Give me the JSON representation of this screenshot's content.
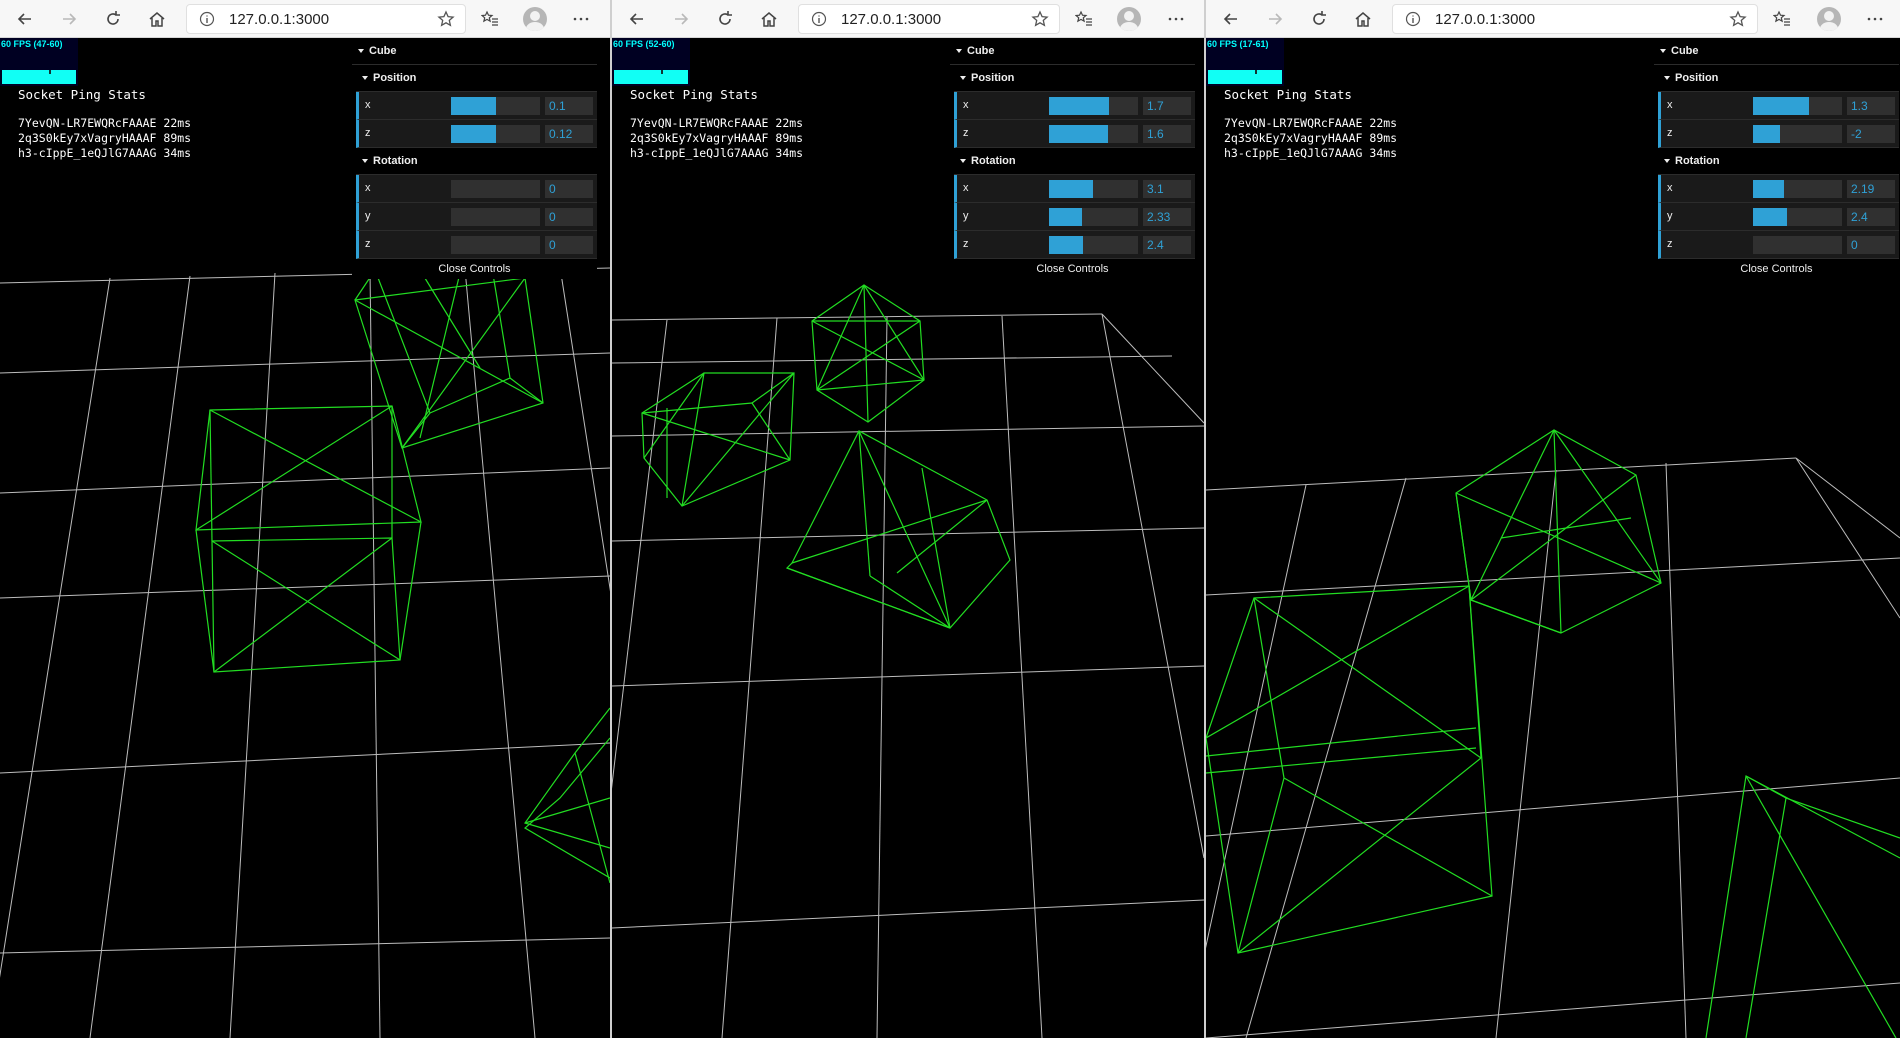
{
  "windows": [
    {
      "url": "127.0.0.1:3000",
      "fps": "60 FPS (47-60)",
      "ping": {
        "title": "Socket Ping Stats",
        "rows": [
          "7YevQN-LR7EWQRcFAAAE 22ms",
          "2q3S0kEy7xVagryHAAAF 89ms",
          "h3-cIppE_1eQJlG7AAAG 34ms"
        ]
      },
      "gui": {
        "folder": "Cube",
        "position_title": "Position",
        "position": [
          {
            "label": "x",
            "value": "0.1",
            "fill": 0.5
          },
          {
            "label": "z",
            "value": "0.12",
            "fill": 0.51
          }
        ],
        "rotation_title": "Rotation",
        "rotation": [
          {
            "label": "x",
            "value": "0",
            "fill": 0
          },
          {
            "label": "y",
            "value": "0",
            "fill": 0
          },
          {
            "label": "z",
            "value": "0",
            "fill": 0
          }
        ],
        "close_label": "Close Controls"
      }
    },
    {
      "url": "127.0.0.1:3000",
      "fps": "60 FPS (52-60)",
      "ping": {
        "title": "Socket Ping Stats",
        "rows": [
          "7YevQN-LR7EWQRcFAAAE 22ms",
          "2q3S0kEy7xVagryHAAAF 89ms",
          "h3-cIppE_1eQJlG7AAAG 34ms"
        ]
      },
      "gui": {
        "folder": "Cube",
        "position_title": "Position",
        "position": [
          {
            "label": "x",
            "value": "1.7",
            "fill": 0.67
          },
          {
            "label": "z",
            "value": "1.6",
            "fill": 0.66
          }
        ],
        "rotation_title": "Rotation",
        "rotation": [
          {
            "label": "x",
            "value": "3.1",
            "fill": 0.49
          },
          {
            "label": "y",
            "value": "2.33",
            "fill": 0.37
          },
          {
            "label": "z",
            "value": "2.4",
            "fill": 0.38
          }
        ],
        "close_label": "Close Controls"
      }
    },
    {
      "url": "127.0.0.1:3000",
      "fps": "60 FPS (17-61)",
      "ping": {
        "title": "Socket Ping Stats",
        "rows": [
          "7YevQN-LR7EWQRcFAAAE 22ms",
          "2q3S0kEy7xVagryHAAAF 89ms",
          "h3-cIppE_1eQJlG7AAAG 34ms"
        ]
      },
      "gui": {
        "folder": "Cube",
        "position_title": "Position",
        "position": [
          {
            "label": "x",
            "value": "1.3",
            "fill": 0.63
          },
          {
            "label": "z",
            "value": "-2",
            "fill": 0.3
          }
        ],
        "rotation_title": "Rotation",
        "rotation": [
          {
            "label": "x",
            "value": "2.19",
            "fill": 0.35
          },
          {
            "label": "y",
            "value": "2.4",
            "fill": 0.38
          },
          {
            "label": "z",
            "value": "0",
            "fill": 0
          }
        ],
        "close_label": "Close Controls"
      }
    }
  ],
  "colors": {
    "accent": "#2fa1d6",
    "wire": "#22dd22",
    "grid": "#bdbdbd",
    "fps_text": "#00ffff"
  }
}
